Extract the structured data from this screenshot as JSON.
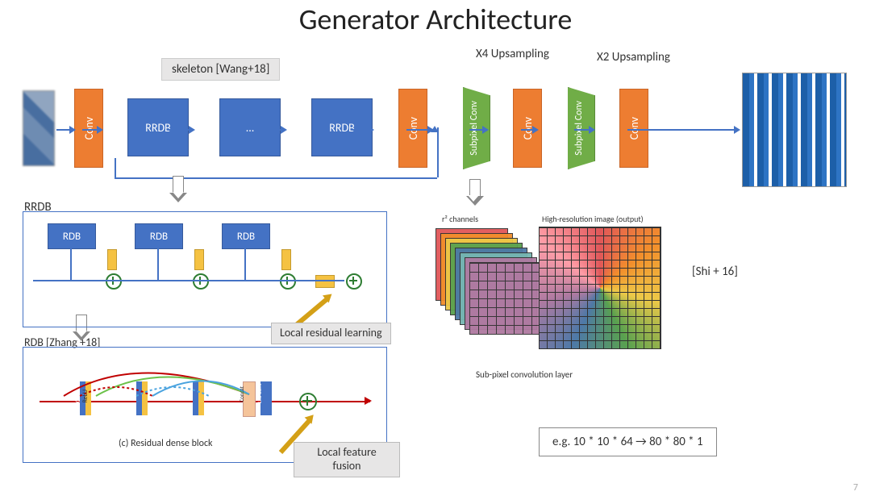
{
  "title": "Generator Architecture",
  "page": "7",
  "labels": {
    "skeleton": "skeleton [Wang+18]",
    "x4": "X4 Upsampling",
    "x2": "X2 Upsampling",
    "conv": "Conv",
    "rrdb": "RRDB",
    "dots": "...",
    "subpixel": "Subpixel Conv"
  },
  "rrdb": {
    "title": "RRDB",
    "rdb": "RDB"
  },
  "rdbbox": {
    "title": "RDB [Zhang +18]",
    "caption": "(c)  Residual dense block",
    "layers": {
      "conv": "Conv",
      "relu": "ReLU",
      "concat": "Concat",
      "oneconv": "1x1 Conv"
    }
  },
  "callouts": {
    "lrl": "Local residual learning",
    "lff": "Local feature fusion"
  },
  "subpix": {
    "stack": "r² channels",
    "out": "High-resolution image (output)",
    "caption": "Sub-pixel convolution layer",
    "cite": "[Shi + 16]"
  },
  "example": "e.g. 10 * 10 * 64 → 80 * 80 * 1",
  "chart_data": {
    "type": "diagram",
    "pipeline": [
      {
        "name": "input-lr-image",
        "kind": "image"
      },
      {
        "name": "conv",
        "kind": "conv"
      },
      {
        "name": "rrdb",
        "kind": "rrdb",
        "repeat": true
      },
      {
        "name": "conv",
        "kind": "conv"
      },
      {
        "name": "subpixel-conv",
        "kind": "upsample",
        "scale": 4
      },
      {
        "name": "conv",
        "kind": "conv"
      },
      {
        "name": "subpixel-conv",
        "kind": "upsample",
        "scale": 2
      },
      {
        "name": "conv",
        "kind": "conv"
      },
      {
        "name": "output-hr-image",
        "kind": "image"
      }
    ],
    "skip_connection": {
      "from": "after-first-conv",
      "to": "before-second-conv"
    },
    "rrdb_expansion": {
      "contains": [
        "RDB",
        "RDB",
        "RDB"
      ],
      "residual_scale": true,
      "global_residual": true
    },
    "rdb_expansion": {
      "layers": [
        "Conv+ReLU",
        "Conv+ReLU",
        "Conv+ReLU",
        "Concat",
        "1x1 Conv"
      ],
      "dense_connections": true,
      "local_residual": true
    },
    "example_shapes": {
      "in": "10*10*64",
      "out": "80*80*1"
    }
  }
}
